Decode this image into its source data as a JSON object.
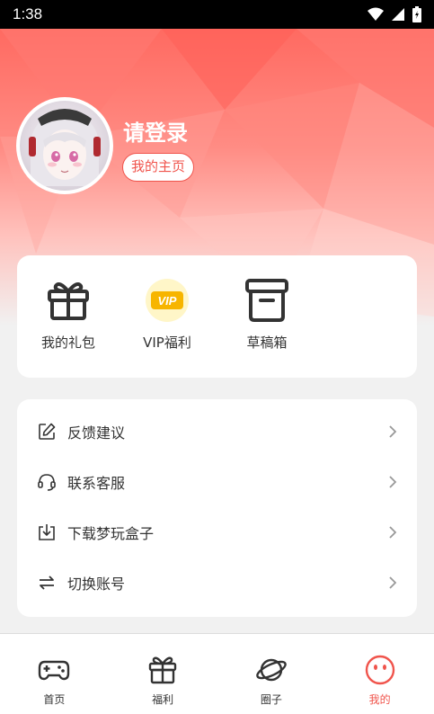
{
  "status_bar": {
    "time": "1:38",
    "icons": [
      "wifi-icon",
      "signal-icon",
      "battery-icon"
    ]
  },
  "profile": {
    "title": "请登录",
    "home_button": "我的主页",
    "avatar": "anime-avatar"
  },
  "actions": [
    {
      "label": "我的礼包",
      "icon": "gift-icon"
    },
    {
      "label": "VIP福利",
      "icon": "vip-badge-icon"
    },
    {
      "label": "草稿箱",
      "icon": "archive-box-icon"
    }
  ],
  "menu": [
    {
      "label": "反馈建议",
      "icon": "edit-icon"
    },
    {
      "label": "联系客服",
      "icon": "headset-icon"
    },
    {
      "label": "下载梦玩盒子",
      "icon": "download-icon"
    },
    {
      "label": "切换账号",
      "icon": "switch-arrows-icon"
    }
  ],
  "tabs": [
    {
      "label": "首页",
      "icon": "gamepad-icon"
    },
    {
      "label": "福利",
      "icon": "gift-icon"
    },
    {
      "label": "圈子",
      "icon": "planet-icon"
    },
    {
      "label": "我的",
      "icon": "face-icon",
      "active": true
    }
  ],
  "colors": {
    "accent": "#f0544c",
    "hero_top": "#ff6a61",
    "vip": "#f7b500"
  }
}
